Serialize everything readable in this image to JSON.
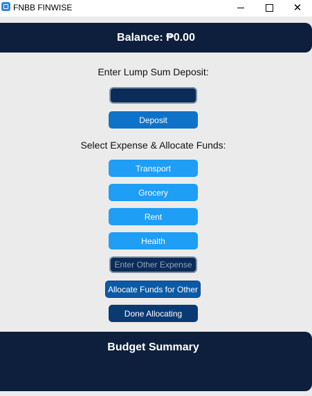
{
  "window": {
    "title": "FNBB FINWISE",
    "icon": "app-icon",
    "controls": [
      "minimize-icon",
      "maximize-icon",
      "close-icon"
    ]
  },
  "balance": {
    "text": "Balance: ₱0.00"
  },
  "deposit": {
    "prompt": "Enter Lump Sum Deposit:",
    "input_value": "",
    "input_placeholder": "",
    "button_label": "Deposit"
  },
  "expenses": {
    "prompt": "Select Expense & Allocate Funds:",
    "items": [
      {
        "label": "Transport"
      },
      {
        "label": "Grocery"
      },
      {
        "label": "Rent"
      },
      {
        "label": "Health"
      }
    ],
    "other_input_value": "",
    "other_placeholder": "Enter Other Expense",
    "allocate_other_label": "Allocate Funds for Other",
    "done_label": "Done Allocating"
  },
  "summary": {
    "title": "Budget Summary"
  },
  "colors": {
    "panel": "#0d1f3c",
    "deposit_button": "#0f72c9",
    "expense_button": "#1e9ef5",
    "done_button": "#0b3a73",
    "background": "#ebebeb"
  }
}
